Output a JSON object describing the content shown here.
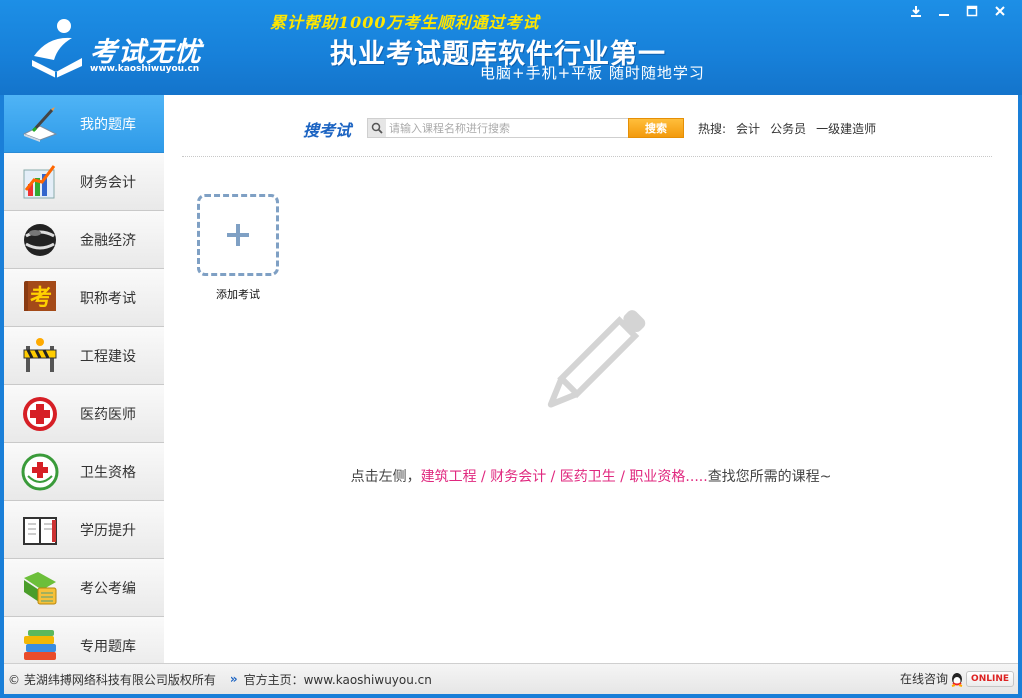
{
  "header": {
    "logo_name": "考试无忧",
    "logo_url": "www.kaoshiwuyou.cn",
    "slogan_top": "累计帮助1000万考生顺利通过考试",
    "slogan_main": "执业考试题库软件行业第一",
    "slogan_sub": "电脑+手机+平板  随时随地学习",
    "window_controls": [
      "download-icon",
      "minimize-icon",
      "maximize-icon",
      "close-icon"
    ]
  },
  "sidebar": {
    "items": [
      {
        "label": "我的题库",
        "icon": "book-pen-icon",
        "active": true
      },
      {
        "label": "财务会计",
        "icon": "bar-chart-icon",
        "active": false
      },
      {
        "label": "金融经济",
        "icon": "globe-icon",
        "active": false
      },
      {
        "label": "职称考试",
        "icon": "kao-book-icon",
        "active": false
      },
      {
        "label": "工程建设",
        "icon": "construction-barrier-icon",
        "active": false
      },
      {
        "label": "医药医师",
        "icon": "medical-cross-icon",
        "active": false
      },
      {
        "label": "卫生资格",
        "icon": "hospital-badge-icon",
        "active": false
      },
      {
        "label": "学历提升",
        "icon": "notebook-icon",
        "active": false
      },
      {
        "label": "考公考编",
        "icon": "calculator-folder-icon",
        "active": false
      },
      {
        "label": "专用题库",
        "icon": "book-stack-icon",
        "active": false
      }
    ]
  },
  "search": {
    "title": "搜考试",
    "placeholder": "请输入课程名称进行搜索",
    "value": "",
    "button_label": "搜索",
    "hot_label": "热搜:",
    "hot_links": [
      "会计",
      "公务员",
      "一级建造师"
    ]
  },
  "main": {
    "add_exam_label": "添加考试",
    "hint_prefix": "点击左侧，",
    "hint_highlight": "建筑工程 / 财务会计 / 医药卫生 / 职业资格.....",
    "hint_suffix": "查找您所需的课程~"
  },
  "footer": {
    "copyright": "© 芜湖纬搏网络科技有限公司版权所有",
    "separator": "»",
    "site_label": "官方主页：www.kaoshiwuyou.cn",
    "consult_label": "在线咨询",
    "online_badge": "ONLINE"
  },
  "colors": {
    "header_blue": "#1780d9",
    "active_item": "#2e9ae8",
    "search_title": "#1b63c2",
    "search_button": "#f39a0c",
    "hint_highlight": "#e0287f"
  }
}
